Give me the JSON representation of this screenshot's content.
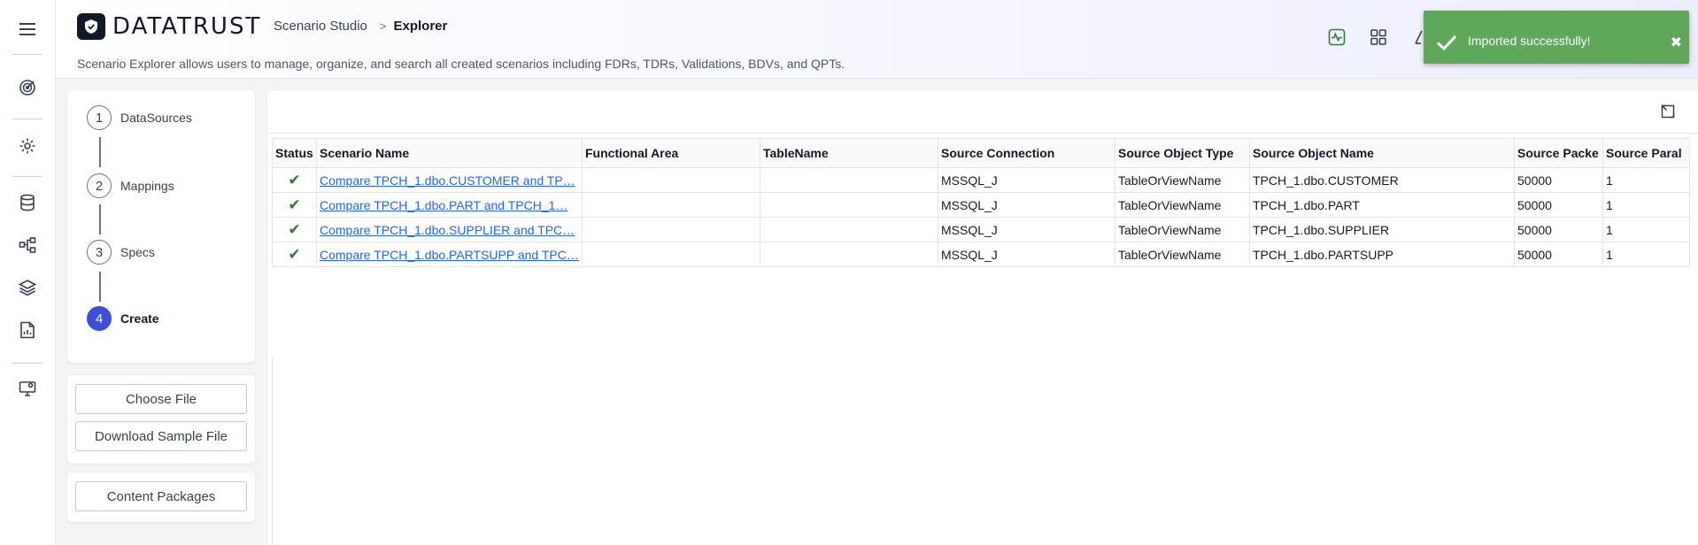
{
  "app": {
    "logo_text": "DATATRUST",
    "breadcrumb": [
      "Scenario Studio",
      "Explorer"
    ],
    "description": "Scenario Explorer allows users to manage, organize, and search all created scenarios including FDRs, TDRs, Validations, BDVs, and QPTs."
  },
  "sidebar": {
    "icons": [
      "menu-icon",
      "target-icon",
      "gear-icon",
      "database-icon",
      "graph-nodes-icon",
      "layers-icon",
      "report-icon",
      "monitor-settings-icon"
    ]
  },
  "toast": {
    "message": "Imported successfully!",
    "close": "✖",
    "color": "#5fa85a"
  },
  "stepper": {
    "steps": [
      {
        "number": "1",
        "label": "DataSources"
      },
      {
        "number": "2",
        "label": "Mappings"
      },
      {
        "number": "3",
        "label": "Specs"
      },
      {
        "number": "4",
        "label": "Create"
      }
    ],
    "active_step": 4,
    "accent_color": "#3b4fd8"
  },
  "actions": {
    "choose_file": "Choose File",
    "download_sample": "Download Sample File",
    "content_packages": "Content Packages"
  },
  "grid": {
    "columns": [
      "Status",
      "Scenario Name",
      "Functional Area",
      "TableName",
      "Source Connection",
      "Source Object Type",
      "Source Object Name",
      "Source Packe",
      "Source Paral"
    ],
    "rows": [
      {
        "status": "✔",
        "scenario_name": "Compare TPCH_1.dbo.CUSTOMER and TP…",
        "functional_area": "",
        "table_name": "",
        "source_connection": "MSSQL_J",
        "source_object_type": "TableOrViewName",
        "source_object_name": "TPCH_1.dbo.CUSTOMER",
        "source_packet": "50000",
        "source_parallel": "1"
      },
      {
        "status": "✔",
        "scenario_name": "Compare TPCH_1.dbo.PART and TPCH_1…",
        "functional_area": "",
        "table_name": "",
        "source_connection": "MSSQL_J",
        "source_object_type": "TableOrViewName",
        "source_object_name": "TPCH_1.dbo.PART",
        "source_packet": "50000",
        "source_parallel": "1"
      },
      {
        "status": "✔",
        "scenario_name": "Compare TPCH_1.dbo.SUPPLIER and TPC…",
        "functional_area": "",
        "table_name": "",
        "source_connection": "MSSQL_J",
        "source_object_type": "TableOrViewName",
        "source_object_name": "TPCH_1.dbo.SUPPLIER",
        "source_packet": "50000",
        "source_parallel": "1"
      },
      {
        "status": "✔",
        "scenario_name": "Compare TPCH_1.dbo.PARTSUPP and TPC…",
        "functional_area": "",
        "table_name": "",
        "source_connection": "MSSQL_J",
        "source_object_type": "TableOrViewName",
        "source_object_name": "TPCH_1.dbo.PARTSUPP",
        "source_packet": "50000",
        "source_parallel": "1"
      }
    ],
    "status_color": "#2e7d32",
    "link_color": "#2563eb"
  }
}
